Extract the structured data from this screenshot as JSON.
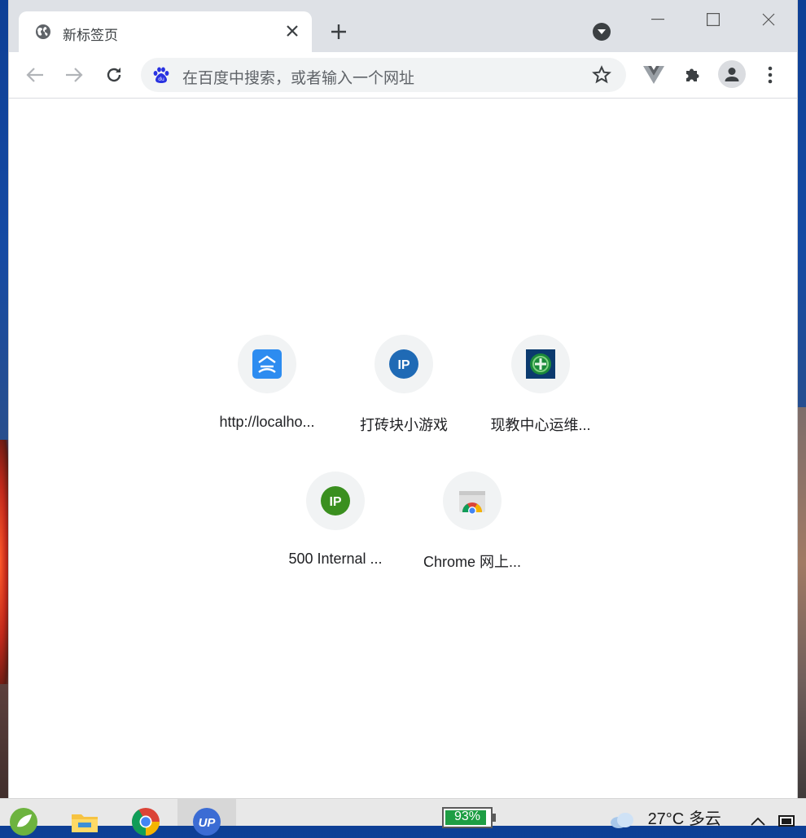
{
  "browser": {
    "tab": {
      "title": "新标签页"
    },
    "omnibox": {
      "placeholder": "在百度中搜索，或者输入一个网址"
    }
  },
  "shortcuts": [
    {
      "label": "http://localho...",
      "icon": "blue-house-favicon-icon"
    },
    {
      "label": "打砖块小游戏",
      "icon": "ip-blue-favicon-icon"
    },
    {
      "label": "现教中心运维...",
      "icon": "green-emblem-favicon-icon"
    },
    {
      "label": "500 Internal ...",
      "icon": "ip-green-favicon-icon"
    },
    {
      "label": "Chrome 网上...",
      "icon": "chrome-web-store-icon"
    }
  ],
  "taskbar": {
    "battery_percent": "93%",
    "battery_level": 0.93,
    "weather": {
      "temperature": "27°C",
      "condition": "多云"
    }
  },
  "colors": {
    "titlebar": "#dee1e6",
    "omnibox": "#f1f3f4",
    "shortcut_bg": "#f1f3f4",
    "battery_fill": "#1e9e44"
  }
}
